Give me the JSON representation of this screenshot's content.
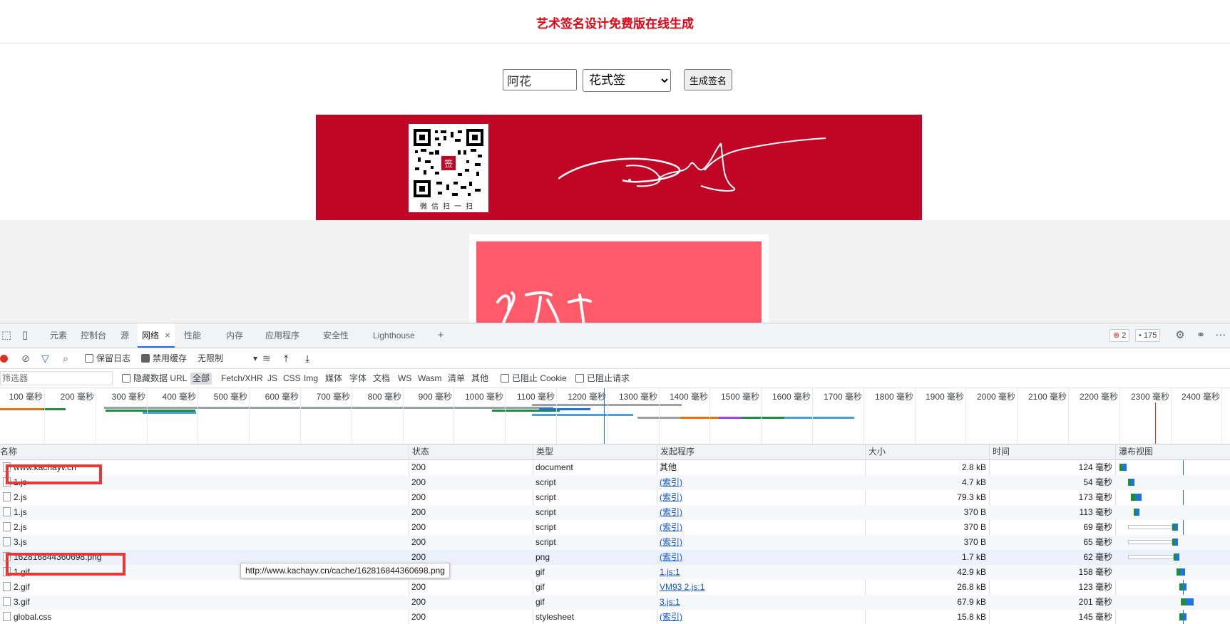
{
  "page": {
    "title": "艺术签名设计免费版在线生成",
    "name_value": "阿花",
    "style_selected": "花式签",
    "generate_label": "生成签名",
    "qr_caption": "微信扫一扫",
    "colors": {
      "title": "#e60012",
      "banner": "#c00525",
      "card": "#ff5a6a"
    }
  },
  "devtools": {
    "tabs": [
      {
        "label": "元素"
      },
      {
        "label": "控制台"
      },
      {
        "label": "源"
      },
      {
        "label": "网络",
        "active": true
      },
      {
        "label": "性能"
      },
      {
        "label": "内存"
      },
      {
        "label": "应用程序"
      },
      {
        "label": "安全性"
      },
      {
        "label": "Lighthouse"
      }
    ],
    "close_glyph": "×",
    "add_glyph": "+",
    "errors_count": "2",
    "messages_count": "175",
    "toolbar": {
      "preserve_log": "保留日志",
      "disable_cache": "禁用缓存",
      "throttling": "无限制"
    },
    "filter": {
      "placeholder": "筛选器",
      "hide_data_urls": "隐藏数据 URL",
      "types": [
        "全部",
        "Fetch/XHR",
        "JS",
        "CSS",
        "Img",
        "媒体",
        "字体",
        "文档",
        "WS",
        "Wasm",
        "清单",
        "其他"
      ],
      "blocked_cookies": "已阻止 Cookie",
      "blocked_requests": "已阻止请求"
    },
    "timeline_ticks": [
      "100 毫秒",
      "200 毫秒",
      "300 毫秒",
      "400 毫秒",
      "500 毫秒",
      "600 毫秒",
      "700 毫秒",
      "800 毫秒",
      "900 毫秒",
      "1000 毫秒",
      "1100 毫秒",
      "1200 毫秒",
      "1300 毫秒",
      "1400 毫秒",
      "1500 毫秒",
      "1600 毫秒",
      "1700 毫秒",
      "1800 毫秒",
      "1900 毫秒",
      "2000 毫秒",
      "2100 毫秒",
      "2200 毫秒",
      "2300 毫秒",
      "2400 毫秒"
    ],
    "columns": {
      "name": "名称",
      "status": "状态",
      "type": "类型",
      "initiator": "发起程序",
      "size": "大小",
      "time": "时间",
      "waterfall": "瀑布视图"
    },
    "requests": [
      {
        "name": "www.kachayv.cn",
        "status": "200",
        "type": "document",
        "initiator": "其他",
        "initiator_link": false,
        "size": "2.8 kB",
        "time": "124 毫秒"
      },
      {
        "name": "1.js",
        "status": "200",
        "type": "script",
        "initiator": "(索引)",
        "initiator_link": true,
        "size": "4.7 kB",
        "time": "54 毫秒"
      },
      {
        "name": "2.js",
        "status": "200",
        "type": "script",
        "initiator": "(索引)",
        "initiator_link": true,
        "size": "79.3 kB",
        "time": "173 毫秒"
      },
      {
        "name": "1.js",
        "status": "200",
        "type": "script",
        "initiator": "(索引)",
        "initiator_link": true,
        "size": "370 B",
        "time": "113 毫秒"
      },
      {
        "name": "2.js",
        "status": "200",
        "type": "script",
        "initiator": "(索引)",
        "initiator_link": true,
        "size": "370 B",
        "time": "69 毫秒"
      },
      {
        "name": "3.js",
        "status": "200",
        "type": "script",
        "initiator": "(索引)",
        "initiator_link": true,
        "size": "370 B",
        "time": "65 毫秒"
      },
      {
        "name": "162816844360698.png",
        "status": "200",
        "type": "png",
        "initiator": "(索引)",
        "initiator_link": true,
        "size": "1.7 kB",
        "time": "62 毫秒"
      },
      {
        "name": "1.gif",
        "status": "200",
        "type": "gif",
        "initiator": "1.js:1",
        "initiator_link": true,
        "size": "42.9 kB",
        "time": "158 毫秒"
      },
      {
        "name": "2.gif",
        "status": "200",
        "type": "gif",
        "initiator": "VM93 2.js:1",
        "initiator_link": true,
        "size": "26.8 kB",
        "time": "123 毫秒"
      },
      {
        "name": "3.gif",
        "status": "200",
        "type": "gif",
        "initiator": "3.js:1",
        "initiator_link": true,
        "size": "67.9 kB",
        "time": "201 毫秒"
      },
      {
        "name": "global.css",
        "status": "200",
        "type": "stylesheet",
        "initiator": "(索引)",
        "initiator_link": true,
        "size": "15.8 kB",
        "time": "145 毫秒"
      }
    ],
    "tooltip": "http://www.kachayv.cn/cache/162816844360698.png"
  }
}
